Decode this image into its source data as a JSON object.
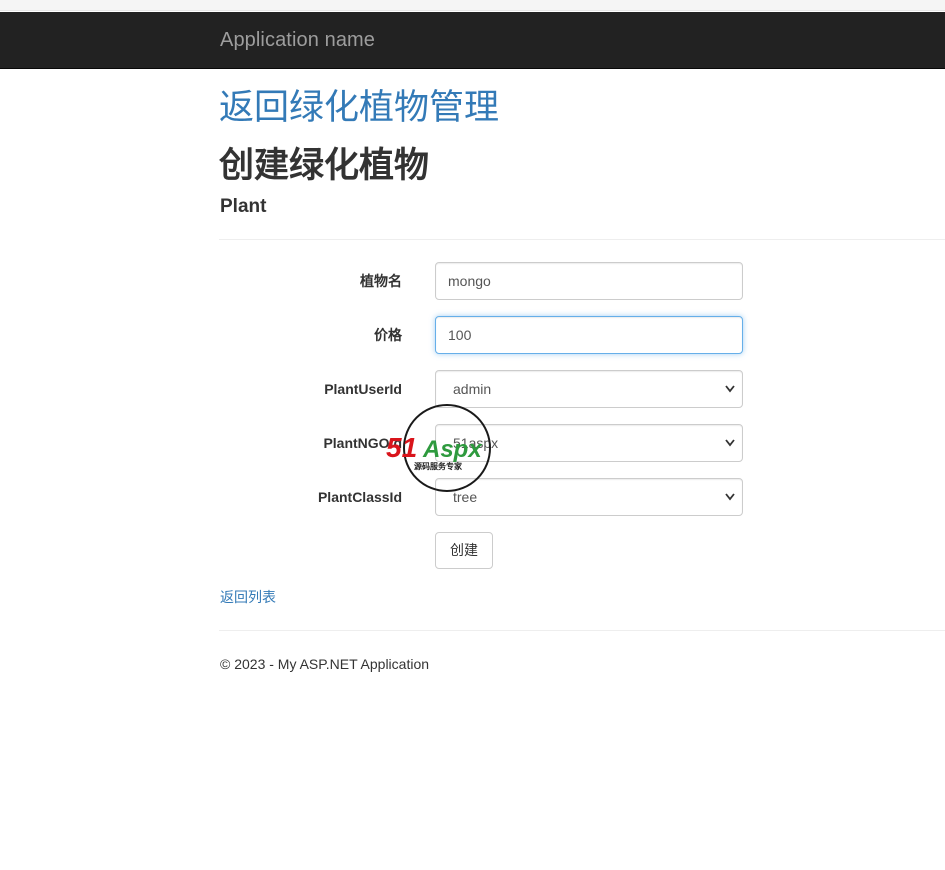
{
  "navbar": {
    "brand": "Application name"
  },
  "header": {
    "back_link": "返回绿化植物管理",
    "title": "创建绿化植物",
    "subtitle": "Plant"
  },
  "form": {
    "fields": [
      {
        "label": "植物名",
        "value": "mongo",
        "type": "text"
      },
      {
        "label": "价格",
        "value": "100",
        "type": "text",
        "focused": true
      },
      {
        "label": "PlantUserId",
        "value": "admin",
        "type": "select"
      },
      {
        "label": "PlantNGOId",
        "value": "51aspx",
        "type": "select"
      },
      {
        "label": "PlantClassId",
        "value": "tree",
        "type": "select"
      }
    ],
    "submit_label": "创建"
  },
  "back_to_list": "返回列表",
  "footer": {
    "text": "© 2023 - My ASP.NET Application"
  },
  "watermark": {
    "brand_red": "51",
    "brand_green": "Aspx",
    "tagline": "源码服务专家"
  },
  "colors": {
    "navbar_bg": "#222222",
    "link": "#337ab7",
    "focus_border": "#66afe9"
  }
}
